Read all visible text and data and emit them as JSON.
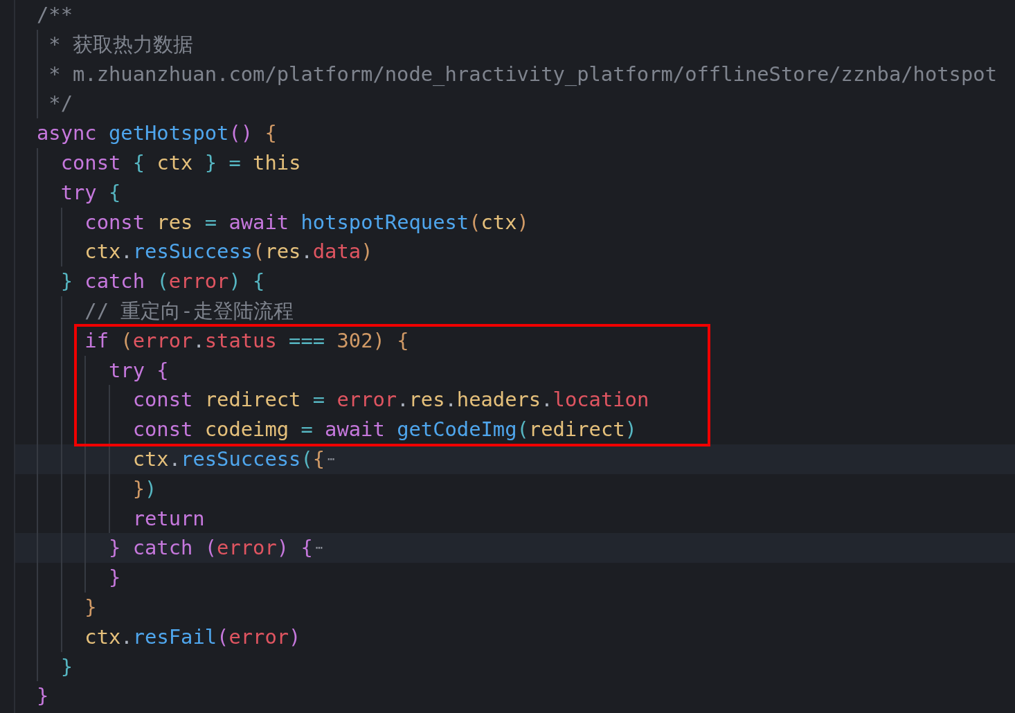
{
  "lines": [
    {
      "tokens": [
        {
          "text": "/**",
          "kind": "comment"
        }
      ],
      "children": [
        {
          "tokens": [
            {
              "text": "* 获取热力数据",
              "kind": "comment"
            }
          ]
        },
        {
          "tokens": [
            {
              "text": "* m.zhuanzhuan.com/platform/node_hractivity_platform/offlineStore/zznba/hotspot",
              "kind": "comment"
            }
          ]
        },
        {
          "tokens": [
            {
              "text": "*/",
              "kind": "comment"
            }
          ]
        }
      ]
    },
    {
      "tokens": [
        {
          "text": "async",
          "kind": "keyword"
        },
        {
          "text": " getHotspot",
          "kind": "function"
        },
        {
          "text": "()",
          "kind": "bracket_purple"
        },
        {
          "text": " {",
          "kind": "bracket_gold"
        }
      ],
      "children": [
        {
          "tokens": [
            {
              "text": "const",
              "kind": "keyword"
            },
            {
              "text": " {",
              "kind": "bracket_teal"
            },
            {
              "text": " ctx",
              "kind": "variable"
            },
            {
              "text": " }",
              "kind": "bracket_teal"
            },
            {
              "text": " =",
              "kind": "operator"
            },
            {
              "text": " this",
              "kind": "variable"
            }
          ]
        },
        {
          "tokens": [
            {
              "text": "try",
              "kind": "keyword"
            },
            {
              "text": " {",
              "kind": "bracket_teal"
            }
          ],
          "children": [
            {
              "tokens": [
                {
                  "text": "const",
                  "kind": "keyword"
                },
                {
                  "text": " res",
                  "kind": "variable"
                },
                {
                  "text": " =",
                  "kind": "operator"
                },
                {
                  "text": " await",
                  "kind": "keyword"
                },
                {
                  "text": " hotspotRequest",
                  "kind": "function"
                },
                {
                  "text": "(",
                  "kind": "bracket_gold"
                },
                {
                  "text": "ctx",
                  "kind": "variable"
                },
                {
                  "text": ")",
                  "kind": "bracket_gold"
                }
              ]
            },
            {
              "tokens": [
                {
                  "text": "ctx",
                  "kind": "variable"
                },
                {
                  "text": ".",
                  "kind": "plain"
                },
                {
                  "text": "resSuccess",
                  "kind": "function"
                },
                {
                  "text": "(",
                  "kind": "bracket_gold"
                },
                {
                  "text": "res",
                  "kind": "variable"
                },
                {
                  "text": ".",
                  "kind": "plain"
                },
                {
                  "text": "data",
                  "kind": "property"
                },
                {
                  "text": ")",
                  "kind": "bracket_gold"
                }
              ]
            }
          ]
        },
        {
          "tokens": [
            {
              "text": "}",
              "kind": "bracket_teal"
            },
            {
              "text": " catch",
              "kind": "keyword"
            },
            {
              "text": " (",
              "kind": "bracket_teal"
            },
            {
              "text": "error",
              "kind": "property"
            },
            {
              "text": ")",
              "kind": "bracket_teal"
            },
            {
              "text": " {",
              "kind": "bracket_teal"
            }
          ],
          "children": [
            {
              "tokens": [
                {
                  "text": "// 重定向-走登陆流程",
                  "kind": "comment"
                }
              ]
            },
            {
              "boxed": true,
              "tokens": [
                {
                  "text": "if",
                  "kind": "keyword"
                },
                {
                  "text": " (",
                  "kind": "bracket_gold"
                },
                {
                  "text": "error",
                  "kind": "property"
                },
                {
                  "text": ".",
                  "kind": "plain"
                },
                {
                  "text": "status",
                  "kind": "property"
                },
                {
                  "text": " ===",
                  "kind": "operator"
                },
                {
                  "text": " 302",
                  "kind": "number"
                },
                {
                  "text": ")",
                  "kind": "bracket_gold"
                },
                {
                  "text": " {",
                  "kind": "bracket_gold"
                }
              ],
              "children": [
                {
                  "boxed": true,
                  "tokens": [
                    {
                      "text": "try",
                      "kind": "keyword"
                    },
                    {
                      "text": " {",
                      "kind": "bracket_purple"
                    }
                  ],
                  "children": [
                    {
                      "boxed": true,
                      "tokens": [
                        {
                          "text": "const",
                          "kind": "keyword"
                        },
                        {
                          "text": " redirect",
                          "kind": "variable"
                        },
                        {
                          "text": " =",
                          "kind": "operator"
                        },
                        {
                          "text": " error",
                          "kind": "property"
                        },
                        {
                          "text": ".",
                          "kind": "plain"
                        },
                        {
                          "text": "res",
                          "kind": "variable"
                        },
                        {
                          "text": ".",
                          "kind": "plain"
                        },
                        {
                          "text": "headers",
                          "kind": "variable"
                        },
                        {
                          "text": ".",
                          "kind": "plain"
                        },
                        {
                          "text": "location",
                          "kind": "property"
                        }
                      ]
                    },
                    {
                      "boxed": true,
                      "tokens": [
                        {
                          "text": "const",
                          "kind": "keyword"
                        },
                        {
                          "text": " codeimg",
                          "kind": "variable"
                        },
                        {
                          "text": " =",
                          "kind": "operator"
                        },
                        {
                          "text": " await",
                          "kind": "keyword"
                        },
                        {
                          "text": " getCodeImg",
                          "kind": "function"
                        },
                        {
                          "text": "(",
                          "kind": "bracket_teal"
                        },
                        {
                          "text": "redirect",
                          "kind": "variable"
                        },
                        {
                          "text": ")",
                          "kind": "bracket_teal"
                        }
                      ]
                    },
                    {
                      "folded": true,
                      "tokens": [
                        {
                          "text": "ctx",
                          "kind": "variable"
                        },
                        {
                          "text": ".",
                          "kind": "plain"
                        },
                        {
                          "text": "resSuccess",
                          "kind": "function"
                        },
                        {
                          "text": "(",
                          "kind": "bracket_teal"
                        },
                        {
                          "text": "{",
                          "kind": "bracket_gold"
                        },
                        {
                          "text": "⋯",
                          "kind": "fold"
                        }
                      ]
                    },
                    {
                      "tokens": [
                        {
                          "text": "}",
                          "kind": "bracket_gold"
                        },
                        {
                          "text": ")",
                          "kind": "bracket_teal"
                        }
                      ]
                    },
                    {
                      "tokens": [
                        {
                          "text": "return",
                          "kind": "keyword"
                        }
                      ]
                    }
                  ]
                },
                {
                  "folded": true,
                  "tokens": [
                    {
                      "text": "}",
                      "kind": "bracket_purple"
                    },
                    {
                      "text": " catch",
                      "kind": "keyword"
                    },
                    {
                      "text": " (",
                      "kind": "bracket_purple"
                    },
                    {
                      "text": "error",
                      "kind": "property"
                    },
                    {
                      "text": ")",
                      "kind": "bracket_purple"
                    },
                    {
                      "text": " {",
                      "kind": "bracket_purple"
                    },
                    {
                      "text": "⋯",
                      "kind": "fold"
                    }
                  ]
                },
                {
                  "tokens": [
                    {
                      "text": "}",
                      "kind": "bracket_purple"
                    }
                  ]
                }
              ]
            },
            {
              "tokens": [
                {
                  "text": "}",
                  "kind": "bracket_gold"
                }
              ]
            },
            {
              "tokens": [
                {
                  "text": "ctx",
                  "kind": "variable"
                },
                {
                  "text": ".",
                  "kind": "plain"
                },
                {
                  "text": "resFail",
                  "kind": "function"
                },
                {
                  "text": "(",
                  "kind": "bracket_purple"
                },
                {
                  "text": "error",
                  "kind": "property"
                },
                {
                  "text": ")",
                  "kind": "bracket_purple"
                }
              ]
            }
          ]
        },
        {
          "tokens": [
            {
              "text": "}",
              "kind": "bracket_teal"
            }
          ]
        }
      ]
    },
    {
      "tokens": [
        {
          "text": "}",
          "kind": "bracket_purple"
        }
      ]
    }
  ]
}
